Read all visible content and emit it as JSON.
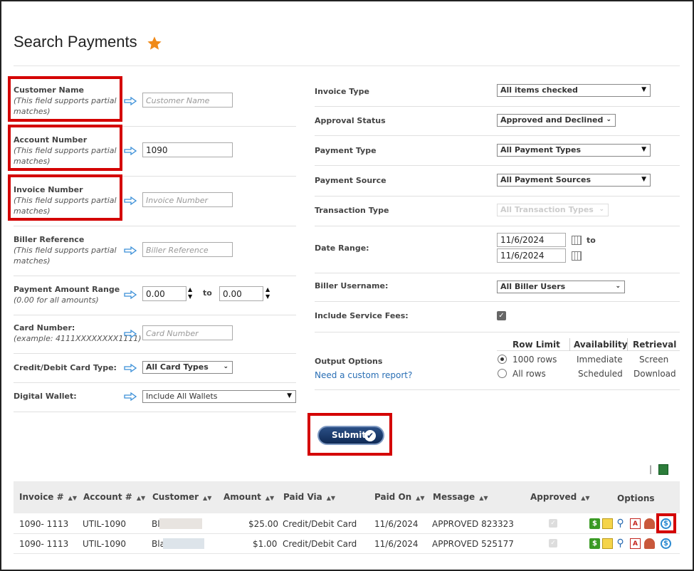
{
  "page": {
    "title": "Search Payments"
  },
  "left_form": {
    "customer_name": {
      "label": "Customer Name",
      "hint": "(This field supports partial matches)",
      "placeholder": "Customer Name"
    },
    "account_number": {
      "label": "Account Number",
      "hint": "(This field supports partial matches)",
      "value": "1090"
    },
    "invoice_number": {
      "label": "Invoice Number",
      "hint": "(This field supports partial matches)",
      "placeholder": "Invoice Number"
    },
    "biller_reference": {
      "label": "Biller Reference",
      "hint": "(This field supports partial matches)",
      "placeholder": "Biller Reference"
    },
    "payment_amount": {
      "label": "Payment Amount Range",
      "hint": "(0.00 for all amounts)",
      "from": "0.00",
      "to_label": "to",
      "to": "0.00"
    },
    "card_number": {
      "label": "Card Number:",
      "hint": "(example: 4111XXXXXXXX1111)",
      "placeholder": "Card Number"
    },
    "card_type": {
      "label": "Credit/Debit Card Type:",
      "selected": "All Card Types"
    },
    "digital_wallet": {
      "label": "Digital Wallet:",
      "selected": "Include All Wallets"
    }
  },
  "right_form": {
    "invoice_type": {
      "label": "Invoice Type",
      "selected": "All items checked"
    },
    "approval_status": {
      "label": "Approval Status",
      "selected": "Approved and Declined"
    },
    "payment_type": {
      "label": "Payment Type",
      "selected": "All Payment Types"
    },
    "payment_source": {
      "label": "Payment Source",
      "selected": "All Payment Sources"
    },
    "transaction_type": {
      "label": "Transaction Type",
      "selected": "All Transaction Types"
    },
    "date_range": {
      "label": "Date Range:",
      "from": "11/6/2024",
      "to_label": "to",
      "to": "11/6/2024"
    },
    "biller_username": {
      "label": "Biller Username:",
      "selected": "All Biller Users"
    },
    "service_fees": {
      "label": "Include Service Fees:",
      "checked": true
    },
    "output_options": {
      "label": "Output Options",
      "custom_report_link": "Need a custom report?",
      "headers": [
        "Row Limit",
        "Availability",
        "Retrieval"
      ],
      "rows": [
        {
          "limit": "1000 rows",
          "availability": "Immediate",
          "retrieval": "Screen",
          "selected": true
        },
        {
          "limit": "All rows",
          "availability": "Scheduled",
          "retrieval": "Download",
          "selected": false
        }
      ]
    }
  },
  "submit_label": "Submit",
  "toolbar": {
    "separator": "|"
  },
  "table": {
    "columns": [
      "Invoice #",
      "Account #",
      "Customer",
      "Amount",
      "Paid Via",
      "Paid On",
      "Message",
      "Approved",
      "Options"
    ],
    "rows": [
      {
        "invoice": "1090- 1113",
        "account": "UTIL-1090",
        "customer": "Bl",
        "amount": "$25.00",
        "paid_via": "Credit/Debit Card",
        "paid_on": "11/6/2024",
        "message": "APPROVED 823323"
      },
      {
        "invoice": "1090- 1113",
        "account": "UTIL-1090",
        "customer": "Bla",
        "amount": "$1.00",
        "paid_via": "Credit/Debit Card",
        "paid_on": "11/6/2024",
        "message": "APPROVED 525177"
      }
    ]
  },
  "icons": {
    "star": "star-icon",
    "arrow": "arrow-right-icon",
    "calendar": "calendar-icon",
    "options": [
      "money-icon",
      "email-icon",
      "search-icon",
      "pdf-icon",
      "user-icon",
      "refund-icon"
    ]
  },
  "colors": {
    "accent_red": "#d40000",
    "submit_blue": "#153267",
    "star_orange": "#f08a18",
    "link_blue": "#2a6fb5"
  }
}
